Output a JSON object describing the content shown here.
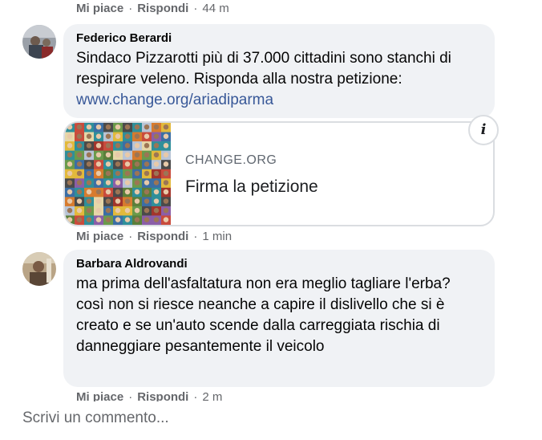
{
  "comments": [
    {
      "actions": {
        "like": "Mi piace",
        "reply": "Rispondi",
        "time": "44 m"
      }
    },
    {
      "author": "Federico Berardi",
      "text": "Sindaco Pizzarotti più di 37.000 cittadini sono stanchi di respirare veleno. Risponda alla nostra petizione:",
      "link": "www.change.org/ariadiparma",
      "link_preview": {
        "domain": "CHANGE.ORG",
        "title": "Firma la petizione",
        "info_icon": "info-icon"
      },
      "actions": {
        "like": "Mi piace",
        "reply": "Rispondi",
        "time": "1 min"
      }
    },
    {
      "author": "Barbara Aldrovandi",
      "text": "ma prima dell'asfaltatura non era meglio tagliare l'erba? così non si riesce neanche a capire il dislivello che si è creato e se un'auto scende dalla carreggiata rischia di danneggiare pesantemente il veicolo",
      "actions": {
        "like": "Mi piace",
        "reply": "Rispondi",
        "time": "2 m"
      }
    }
  ],
  "separator": "·",
  "composer": {
    "placeholder": "Scrivi un commento..."
  },
  "colors": {
    "bubble": "#f0f2f5",
    "meta": "#65676b",
    "link": "#385898"
  }
}
